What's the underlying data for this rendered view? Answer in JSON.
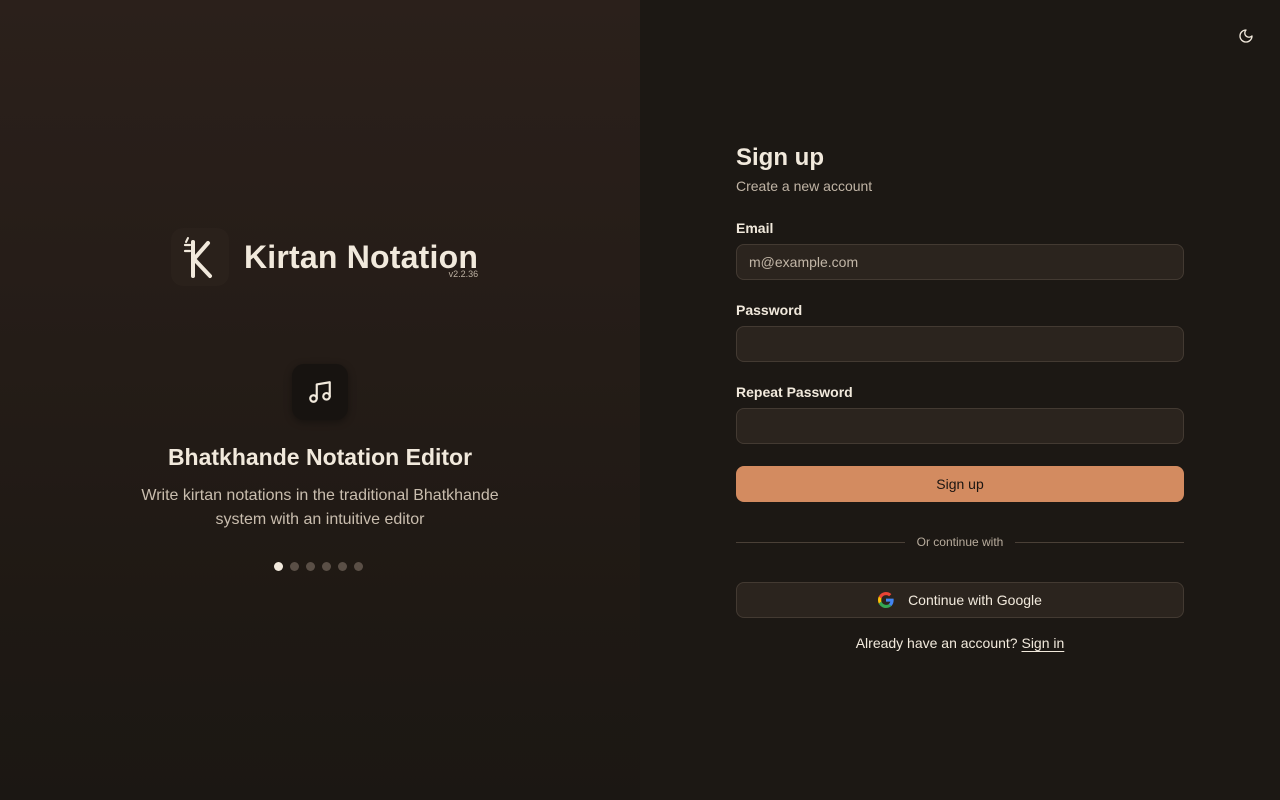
{
  "app": {
    "name": "Kirtan Notation",
    "version": "v2.2.36"
  },
  "carousel": {
    "feature_icon": "music-note-icon",
    "title": "Bhatkhande Notation Editor",
    "description": "Write kirtan notations in the traditional Bhatkhande system with an intuitive editor",
    "slide_count": 6,
    "active_index": 0
  },
  "header": {
    "theme_toggle_icon": "moon-icon"
  },
  "form": {
    "title": "Sign up",
    "subtitle": "Create a new account",
    "email_label": "Email",
    "email_placeholder": "m@example.com",
    "email_value": "",
    "password_label": "Password",
    "password_value": "",
    "repeat_password_label": "Repeat Password",
    "repeat_password_value": "",
    "submit_label": "Sign up",
    "divider_text": "Or continue with",
    "google_label": "Continue with Google",
    "google_icon": "google-icon",
    "have_account_text": "Already have an account?",
    "signin_label": "Sign in"
  },
  "colors": {
    "accent": "#d38b60",
    "background": "#1c1814",
    "text": "#f1e9dc"
  }
}
